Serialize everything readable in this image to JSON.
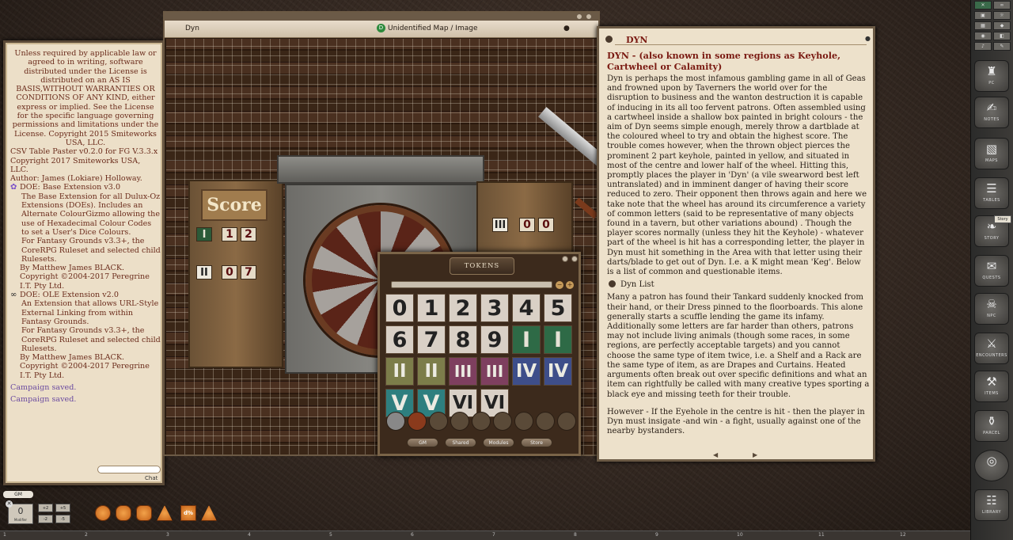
{
  "chat": {
    "lines": [
      "Unless required by applicable law or agreed to in writing, software distributed under the License is distributed on an AS IS BASIS,WITHOUT WARRANTIES OR CONDITIONS OF ANY KIND, either express or implied. See the License for the specific language governing permissions and limitations under the License. Copyright 2015 Smiteworks USA, LLC.",
      "CSV Table Paster v0.2.0 for FG V.3.3.x Copyright 2017 Smiteworks USA, LLC.",
      "Author: James (Lokiare) Holloway.",
      "DOE: Base Extension v3.0",
      "The Base Extension for all Dulux-Oz Extensions (DOEs). Includes an Alternate ColourGizmo allowing the use of Hexadecimal Colour Codes to set a User's Dice Colours.",
      "For Fantasy Grounds v3.3+, the CoreRPG Ruleset and selected child Rulesets.",
      "By Matthew James BLACK.",
      "Copyright ©2004-2017 Peregrine I.T. Pty Ltd.",
      "DOE: OLE Extension v2.0",
      "An Extension that allows URL-Style External Linking from within Fantasy Grounds.",
      "For Fantasy Grounds v3.3+, the CoreRPG Ruleset and selected child Rulesets.",
      "By Matthew James BLACK.",
      "Copyright ©2004-2017 Peregrine I.T. Pty Ltd.",
      "Campaign saved.",
      "Campaign saved."
    ],
    "input_label": "Chat"
  },
  "image_window": {
    "title_left": "Dyn",
    "title_center": "Unidentified Map / Image",
    "score_sign": "Score",
    "score_left": [
      "I",
      "1",
      "2",
      "II",
      "0",
      "7"
    ],
    "score_right": [
      "III",
      "0",
      "0"
    ]
  },
  "tokens": {
    "title": "TOKENS",
    "tokens": [
      "0",
      "1",
      "2",
      "3",
      "4",
      "5",
      "6",
      "7",
      "8",
      "9",
      "I",
      "I",
      "II",
      "II",
      "III",
      "III",
      "IV",
      "IV",
      "V",
      "V",
      "VI",
      "VI"
    ],
    "colors": [
      "w",
      "w",
      "w",
      "w",
      "w",
      "w",
      "w",
      "w",
      "w",
      "w",
      "g",
      "g",
      "o",
      "o",
      "p",
      "p",
      "b",
      "b",
      "t",
      "t",
      "w",
      "w"
    ],
    "buttons": [
      "GM",
      "Shared",
      "Modules",
      "Store"
    ]
  },
  "story": {
    "title": "DYN",
    "heading": "DYN - (also known in some regions as Keyhole, Cartwheel or Calamity)",
    "paragraph1": "Dyn is perhaps the most infamous gambling game in all of Geas and frowned upon by Taverners the world over for the disruption to business and the wanton destruction it is capable of inducing in its all too fervent patrons. Often assembled using a cartwheel inside a shallow box painted in bright colours - the aim of Dyn seems simple enough, merely throw a dartblade at the coloured wheel to try and obtain the highest score. The trouble comes however, when the thrown object pierces the prominent 2 part keyhole, painted in yellow, and situated in most of the centre and lower half of the wheel. Hitting this, promptly places the player in 'Dyn' (a vile swearword best left untranslated) and in imminent danger of having their score reduced to zero. Their opponent then throws again and here we take note that the wheel has around its circumference a variety of common letters (said to be representative of many objects found in a tavern, but other variations abound) . Though the player scores normally (unless they hit the Keyhole) - whatever part of the wheel is hit has a corresponding letter, the player in Dyn must hit something in the Area with that letter using their darts/blade to get out of Dyn. I.e. a K might mean 'Keg'. Below is a list of common and questionable items.",
    "list_title": "Dyn List",
    "paragraph2": "Many a patron has found their Tankard suddenly knocked from their hand, or their Dress pinned to the floorboards. This alone generally starts a scuffle lending the game its infamy. Additionally some letters are far harder than others, patrons may not include living animals (though some races, in some regions, are perfectly acceptable targets)   and you cannot choose the same type of item twice, i.e. a Shelf and a Rack are the same type of item, as are Drapes and Curtains. Heated arguments often break out over specific definitions and what an item can rightfully be called with many creative types sporting a black eye and missing teeth for their trouble.",
    "paragraph3": "However - If the Eyehole in the centre is hit - then the player in Dyn must insigate -and win - a fight, usually against one of the nearby bystanders."
  },
  "sidebar": {
    "buttons": [
      "PC",
      "NOTES",
      "MAPS",
      "TABLES",
      "STORY",
      "QUESTS",
      "NPC",
      "ENCOUNTERS",
      "ITEMS",
      "PARCEL",
      "",
      "LIBRARY"
    ],
    "tooltip": "Story"
  },
  "dice_bar": {
    "gm_label": "GM",
    "modifier_value": "0",
    "modifier_label": "Modifier",
    "mod_buttons": [
      "+2",
      "-2",
      "+5",
      "-5"
    ],
    "dice": [
      "d4",
      "d6",
      "d8",
      "d10",
      "d12",
      "d20",
      "d%"
    ],
    "dice_shown": [
      "",
      "",
      "",
      "",
      "",
      "",
      "d%",
      ""
    ]
  },
  "ruler": [
    "1",
    "2",
    "3",
    "4",
    "5",
    "6",
    "7",
    "8",
    "9",
    "10",
    "11",
    "12"
  ]
}
